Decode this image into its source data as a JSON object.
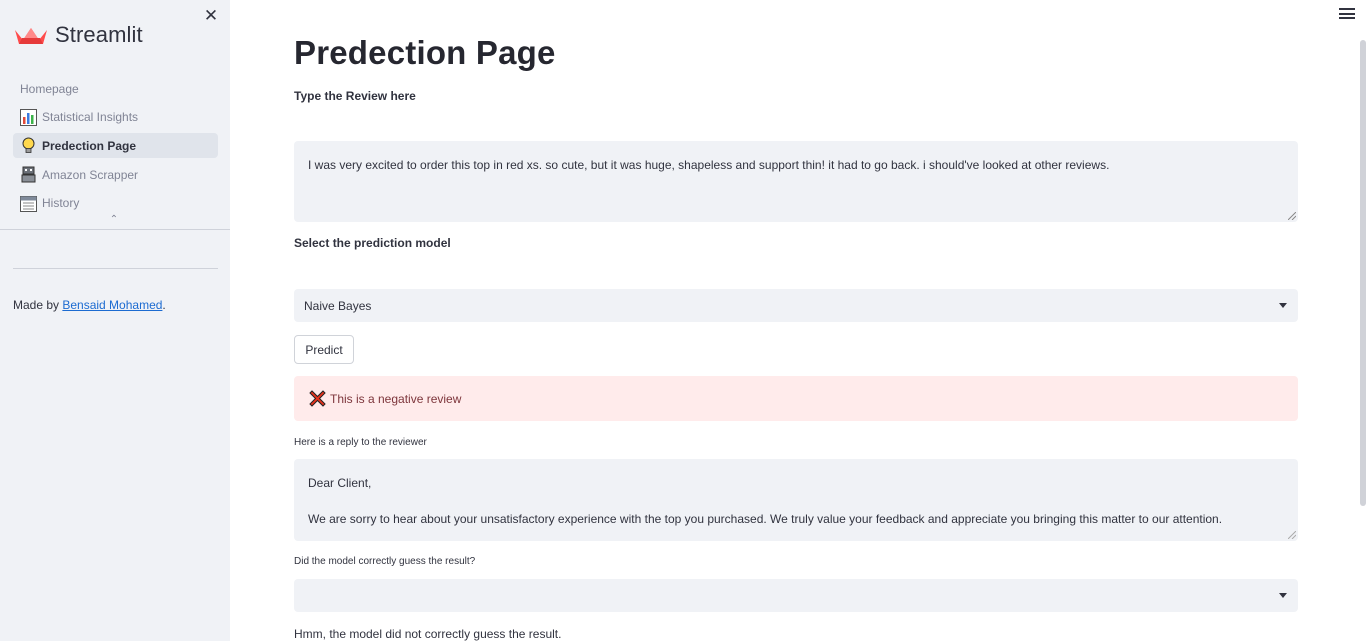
{
  "sidebar": {
    "brand": "Streamlit",
    "items": [
      {
        "label": "Homepage",
        "icon": "none"
      },
      {
        "label": "Statistical Insights",
        "icon": "bar-chart-icon"
      },
      {
        "label": "Predection Page",
        "icon": "light-bulb-icon",
        "active": true
      },
      {
        "label": "Amazon Scrapper",
        "icon": "robot-icon"
      },
      {
        "label": "History",
        "icon": "calendar-icon"
      }
    ],
    "made_by_prefix": "Made by ",
    "made_by_link": "Bensaid Mohamed",
    "made_by_suffix": "."
  },
  "main": {
    "title": "Predection Page",
    "review_label": "Type the Review here",
    "review_text": "I was very excited to order this top in red xs. so cute, but it was huge, shapeless and support thin! it had to go back. i should've looked at other reviews.",
    "model_label": "Select the prediction model",
    "model_value": "Naive Bayes",
    "predict_button": "Predict",
    "result_text": "This is a negative review",
    "reply_label": "Here is a reply to the reviewer",
    "reply_line1": "Dear Client,",
    "reply_line2": "We are sorry to hear about your unsatisfactory experience with the top you purchased. We truly value your feedback and appreciate you bringing this matter to our attention.",
    "feedback_label": "Did the model correctly guess the result?",
    "feedback_value": "",
    "feedback_result": "Hmm, the model did not correctly guess the result."
  },
  "colors": {
    "sidebar_bg": "#f0f2f6",
    "accent": "#ff4b4b",
    "error_bg": "#ffebeb",
    "link": "#1c6bd1"
  }
}
